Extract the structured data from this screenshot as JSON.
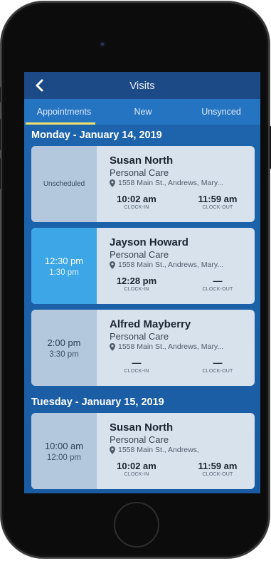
{
  "app": {
    "title": "Visits",
    "tabs": [
      {
        "label": "Appointments",
        "active": true
      },
      {
        "label": "New",
        "active": false
      },
      {
        "label": "Unsynced",
        "active": false
      }
    ],
    "accent_color": "#f3e36a",
    "header_color": "#1c4a86",
    "tab_bar_color": "#2474c2"
  },
  "days": [
    {
      "header": "Monday - January 14, 2019",
      "visits": [
        {
          "left_label": "Unscheduled",
          "client": "Susan North",
          "service": "Personal Care",
          "address": "1558 Main St., Andrews, Mary...",
          "clock_in": "10:02 am",
          "clock_out": "11:59 am",
          "clock_in_label": "CLOCK-IN",
          "clock_out_label": "CLOCK-OUT"
        },
        {
          "start": "12:30 pm",
          "end": "1:30 pm",
          "client": "Jayson Howard",
          "service": "Personal Care",
          "address": "1558 Main St., Andrews, Mary...",
          "clock_in": "12:28 pm",
          "clock_out": "—",
          "clock_in_label": "CLOCK-IN",
          "clock_out_label": "CLOCK-OUT"
        },
        {
          "start": "2:00 pm",
          "end": "3:30 pm",
          "client": "Alfred Mayberry",
          "service": "Personal Care",
          "address": "1558 Main St., Andrews, Mary...",
          "clock_in": "—",
          "clock_out": "—",
          "clock_in_label": "CLOCK-IN",
          "clock_out_label": "CLOCK-OUT"
        }
      ]
    },
    {
      "header": "Tuesday - January 15, 2019",
      "visits": [
        {
          "start": "10:00 am",
          "end": "12:00 pm",
          "client": "Susan North",
          "service": "Personal Care",
          "address": "1558 Main St., Andrews,",
          "clock_in": "10:02 am",
          "clock_out": "11:59 am",
          "clock_in_label": "CLOCK-IN",
          "clock_out_label": "CLOCK-OUT"
        }
      ]
    }
  ]
}
